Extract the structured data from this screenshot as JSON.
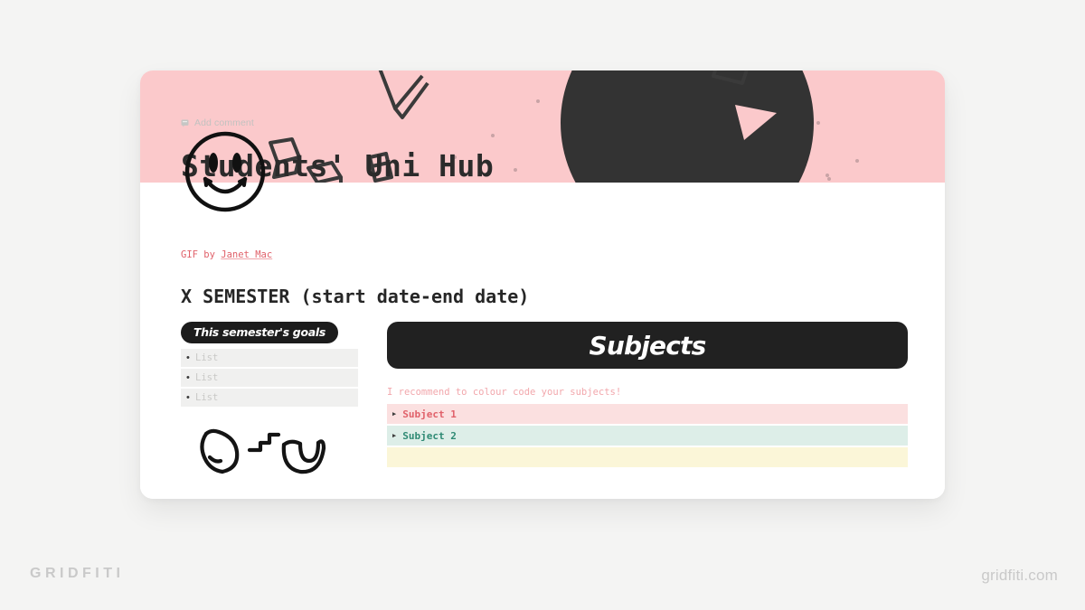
{
  "canvas": {
    "background_color": "#f4f4f3"
  },
  "brand": {
    "left_wordmark": "GRIDFITI",
    "right_url": "gridfiti.com"
  },
  "notion_page": {
    "cover": {
      "background_color": "#fbc9cb",
      "doodles": [
        "smiley-face",
        "cube",
        "cube",
        "cube",
        "checkmark",
        "dark-circle",
        "play-triangle",
        "dots"
      ]
    },
    "page_icon": "smiley-face-icon",
    "add_comment": {
      "icon": "comment-bubble-icon",
      "label": "Add comment"
    },
    "title": "Students' Uni Hub",
    "byline": {
      "prefix": "GIF by ",
      "link_text": "Janet Mac",
      "color": "#e0616a"
    },
    "semester_heading": "X SEMESTER (start date-end date)"
  },
  "goals_block": {
    "pill_label": "This semester's goals",
    "pill_bg": "#1c1c1c",
    "items": [
      {
        "bullet": "•",
        "text": "List"
      },
      {
        "bullet": "•",
        "text": "List"
      },
      {
        "bullet": "•",
        "text": "List"
      }
    ],
    "doodles": [
      "curved-tube-doodle",
      "zigzag-doodle",
      "u-tube-doodle"
    ]
  },
  "subjects_block": {
    "banner_label": "Subjects",
    "banner_bg": "#212121",
    "note": "I recommend to colour code your subjects!",
    "note_color": "#f2a7ac",
    "rows": [
      {
        "toggle": "▶",
        "label": "Subject 1",
        "bg": "#fbe0e0",
        "text_color": "#e0616a"
      },
      {
        "toggle": "▶",
        "label": "Subject 2",
        "bg": "#ddeee8",
        "text_color": "#2f8a74"
      },
      {
        "toggle": "▶",
        "label": "",
        "bg": "#fbf6d8",
        "text_color": "#b79d2a"
      }
    ]
  }
}
